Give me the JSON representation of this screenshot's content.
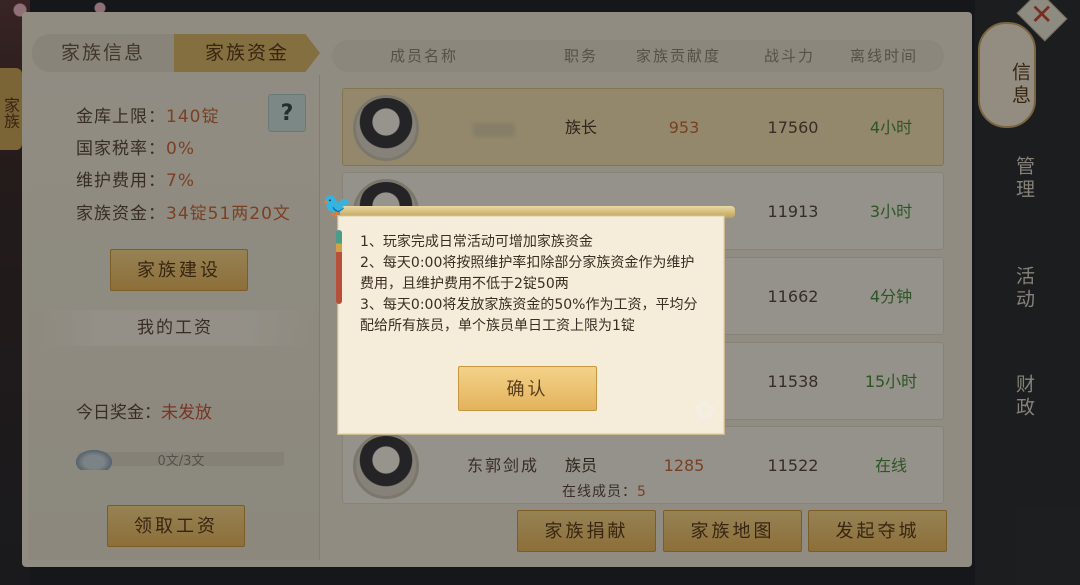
{
  "left_side_tab": "家族",
  "tabs": {
    "info": "家族信息",
    "funds": "家族资金"
  },
  "funds": {
    "vault_limit_label": "金库上限：",
    "vault_limit_value": "140锭",
    "tax_label": "国家税率：",
    "tax_value": "0%",
    "maintenance_label": "维护费用：",
    "maintenance_value": "7%",
    "family_funds_label": "家族资金：",
    "family_funds_value": "34锭51两20文",
    "help_label": "?",
    "build_button": "家族建设",
    "my_salary_title": "我的工资",
    "bonus_label": "今日奖金：",
    "bonus_value": "未发放",
    "salary_progress_text": "0文/3文",
    "salary_progress": 0,
    "claim_button": "领取工资"
  },
  "list": {
    "headers": {
      "name": "成员名称",
      "title": "职务",
      "contribution": "家族贡献度",
      "power": "战斗力",
      "offline": "离线时间"
    },
    "rows": [
      {
        "name": "",
        "title": "族长",
        "contribution": "953",
        "power": "17560",
        "offline": "4小时"
      },
      {
        "name": "",
        "title": "",
        "contribution": "",
        "power": "11913",
        "offline": "3小时"
      },
      {
        "name": "",
        "title": "",
        "contribution": "",
        "power": "11662",
        "offline": "4分钟"
      },
      {
        "name": "",
        "title": "",
        "contribution": "",
        "power": "11538",
        "offline": "15小时"
      },
      {
        "name": "东郭剑成",
        "title": "族员",
        "contribution": "1285",
        "power": "11522",
        "offline": "在线"
      }
    ],
    "online_label": "在线成员：",
    "online_value": "5"
  },
  "bottom_buttons": {
    "donate": "家族捐献",
    "map": "家族地图",
    "siege": "发起夺城"
  },
  "right_menu": {
    "info": "信息",
    "manage": "管理",
    "activity": "活动",
    "finance": "财政"
  },
  "close_label": "✕",
  "dialog": {
    "text": "1、玩家完成日常活动可增加家族资金\n2、每天0:00将按照维护率扣除部分家族资金作为维护费用，且维护费用不低于2锭50两\n3、每天0:00将发放家族资金的50%作为工资，平均分配给所有族员，单个族员单日工资上限为1锭",
    "confirm_button": "确认"
  }
}
